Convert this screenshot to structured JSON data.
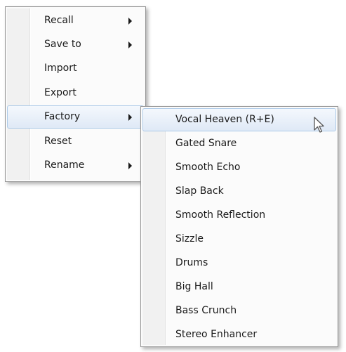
{
  "main_menu": {
    "items": [
      {
        "label": "Recall"
      },
      {
        "label": "Save to"
      },
      {
        "label": "Import"
      },
      {
        "label": "Export"
      },
      {
        "label": "Factory"
      },
      {
        "label": "Reset"
      },
      {
        "label": "Rename"
      }
    ],
    "highlighted": "Factory"
  },
  "factory_submenu": {
    "items": [
      {
        "label": "Vocal Heaven (R+E)"
      },
      {
        "label": "Gated Snare"
      },
      {
        "label": "Smooth Echo"
      },
      {
        "label": "Slap Back"
      },
      {
        "label": "Smooth Reflection"
      },
      {
        "label": "Sizzle"
      },
      {
        "label": "Drums"
      },
      {
        "label": "Big Hall"
      },
      {
        "label": "Bass Crunch"
      },
      {
        "label": "Stereo Enhancer"
      }
    ],
    "highlighted": "Vocal Heaven (R+E)"
  },
  "cursor": {
    "icon": "arrow-pointer-icon"
  },
  "colors": {
    "highlight_border": "#aecbe8",
    "menu_background": "#fbfbfb",
    "menu_border": "#979797"
  }
}
